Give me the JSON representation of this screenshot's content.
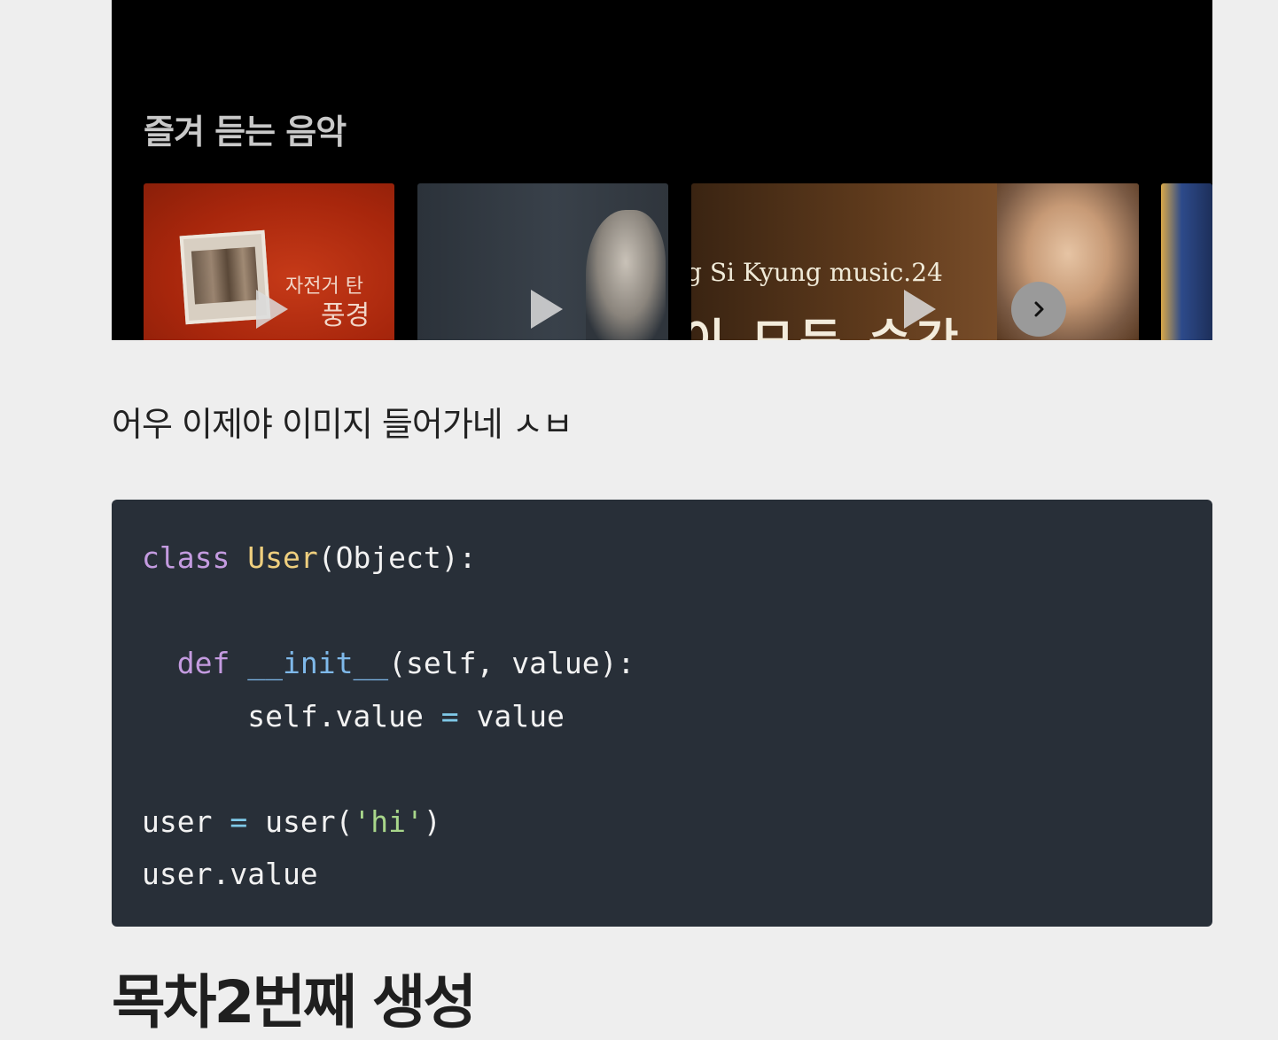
{
  "music": {
    "title": "즐겨 듣는 음악",
    "thumbnails": [
      {
        "cover_text_top": "자전거 탄",
        "cover_text_bottom": "풍경"
      },
      {},
      {
        "title_text": "g Si Kyung music.24",
        "subtitle_text": "이 모든 순간"
      },
      {}
    ],
    "next_icon": "chevron-right-icon"
  },
  "paragraph": "어우 이제야 이미지 들어가네 ㅅㅂ",
  "code": {
    "lines": [
      "class User(Object):",
      "",
      "  def __init__(self, value):",
      "      self.value = value",
      "",
      "user = user('hi')",
      "user.value"
    ]
  },
  "heading": "목차2번째 생성",
  "colors": {
    "page_bg": "#eeeeee",
    "code_bg": "#282f38",
    "keyword": "#c49be0",
    "class_name": "#efcf7e",
    "function": "#7fb9ea",
    "string": "#a8d68a"
  }
}
